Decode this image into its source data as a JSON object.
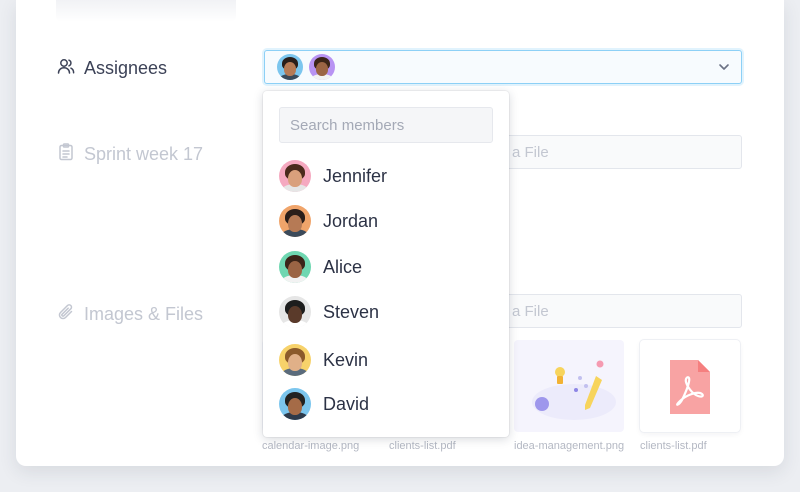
{
  "form": {
    "assignees_label": "Assignees",
    "sprint_label": "Sprint week 17",
    "images_label": "Images & Files",
    "file_field_1": "a File",
    "file_field_2": "a File"
  },
  "assignees": {
    "selected": [
      {
        "name": "Jordan",
        "bg": "#7cc6ee",
        "hair": "#2a1e1a",
        "skin": "#b67a55",
        "shirt": "#3b4a5a"
      },
      {
        "name": "Alice",
        "bg": "#b893f3",
        "hair": "#3b2418",
        "skin": "#9b6444",
        "shirt": "#f2f2f2"
      }
    ]
  },
  "dropdown": {
    "search_placeholder": "Search members",
    "members": [
      {
        "name": "Jennifer",
        "bg": "#f5a9c0",
        "hair": "#4a2a1c",
        "skin": "#d9a07c",
        "shirt": "#e6e6e6"
      },
      {
        "name": "Jordan",
        "bg": "#f0a46a",
        "hair": "#2a1e1a",
        "skin": "#b67a55",
        "shirt": "#3b4a5a"
      },
      {
        "name": "Alice",
        "bg": "#6fd7b1",
        "hair": "#3b2418",
        "skin": "#9b6444",
        "shirt": "#f2f2f2"
      },
      {
        "name": "Steven",
        "bg": "#e6e6e6",
        "hair": "#1d1d1d",
        "skin": "#5a3a2a",
        "shirt": "#ffffff"
      },
      {
        "name": "Kevin",
        "bg": "#f7d26a",
        "hair": "#8b5a2b",
        "skin": "#e0b088",
        "shirt": "#5a6b7c"
      },
      {
        "name": "David",
        "bg": "#7cc6ee",
        "hair": "#222222",
        "skin": "#a56b47",
        "shirt": "#2d3a4b"
      }
    ]
  },
  "files": [
    {
      "name": "calendar-image.png"
    },
    {
      "name": "clients-list.pdf"
    },
    {
      "name": "idea-management.png"
    },
    {
      "name": "clients-list.pdf"
    }
  ],
  "colors": {
    "focus_border": "#8dd0f6",
    "pdf_red": "#f8a3a3",
    "illustration_purple": "#8e86e6"
  }
}
